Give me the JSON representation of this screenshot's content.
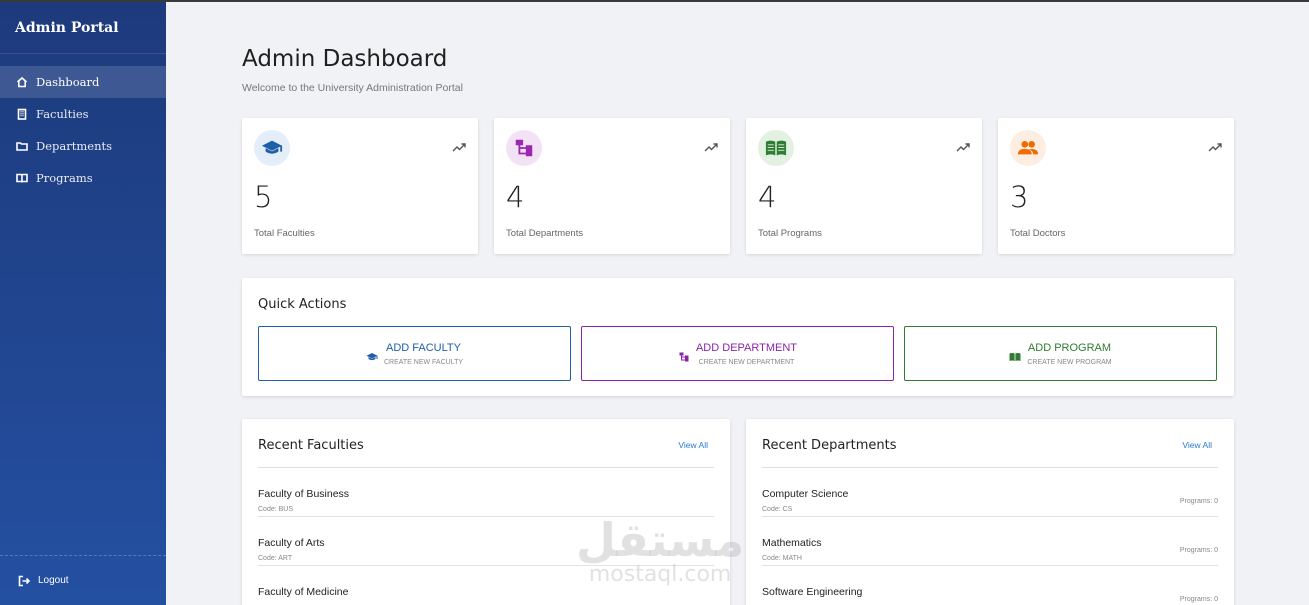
{
  "sidebar": {
    "brand": "Admin Portal",
    "items": [
      {
        "label": "Dashboard",
        "icon": "home-icon",
        "active": true
      },
      {
        "label": "Faculties",
        "icon": "building-icon",
        "active": false
      },
      {
        "label": "Departments",
        "icon": "folder-icon",
        "active": false
      },
      {
        "label": "Programs",
        "icon": "book-icon",
        "active": false
      }
    ],
    "logout": "Logout"
  },
  "header": {
    "title": "Admin Dashboard",
    "subtitle": "Welcome to the University Administration Portal"
  },
  "stats": [
    {
      "value": "5",
      "label": "Total Faculties",
      "icon": "graduation-cap-icon",
      "color": "#1f5fa8",
      "bg": "#e4eef9"
    },
    {
      "value": "4",
      "label": "Total Departments",
      "icon": "hierarchy-icon",
      "color": "#9c27b0",
      "bg": "#f3e2f6"
    },
    {
      "value": "4",
      "label": "Total Programs",
      "icon": "book-icon",
      "color": "#2e7d32",
      "bg": "#e3f1e3"
    },
    {
      "value": "3",
      "label": "Total Doctors",
      "icon": "people-icon",
      "color": "#ef6c00",
      "bg": "#fdeee1"
    }
  ],
  "quick_actions": {
    "title": "Quick Actions",
    "buttons": [
      {
        "label": "ADD FACULTY",
        "sub": "CREATE NEW FACULTY",
        "icon": "graduation-cap-icon",
        "color": "#1f5fa8"
      },
      {
        "label": "ADD DEPARTMENT",
        "sub": "CREATE NEW DEPARTMENT",
        "icon": "hierarchy-icon",
        "color": "#8a24a8"
      },
      {
        "label": "ADD PROGRAM",
        "sub": "CREATE NEW PROGRAM",
        "icon": "book-icon",
        "color": "#2e7d32"
      }
    ]
  },
  "recent_faculties": {
    "title": "Recent Faculties",
    "view_all": "View All",
    "rows": [
      {
        "name": "Faculty of Business",
        "code": "Code: BUS"
      },
      {
        "name": "Faculty of Arts",
        "code": "Code: ART"
      },
      {
        "name": "Faculty of Medicine",
        "code": ""
      }
    ]
  },
  "recent_departments": {
    "title": "Recent Departments",
    "view_all": "View All",
    "rows": [
      {
        "name": "Computer Science",
        "code": "Code: CS",
        "programs": "Programs: 0"
      },
      {
        "name": "Mathematics",
        "code": "Code: MATH",
        "programs": "Programs: 0"
      },
      {
        "name": "Software Engineering",
        "code": "",
        "programs": "Programs: 0"
      }
    ]
  },
  "watermark": {
    "arabic": "مستقل",
    "latin": "mostaql.com"
  }
}
